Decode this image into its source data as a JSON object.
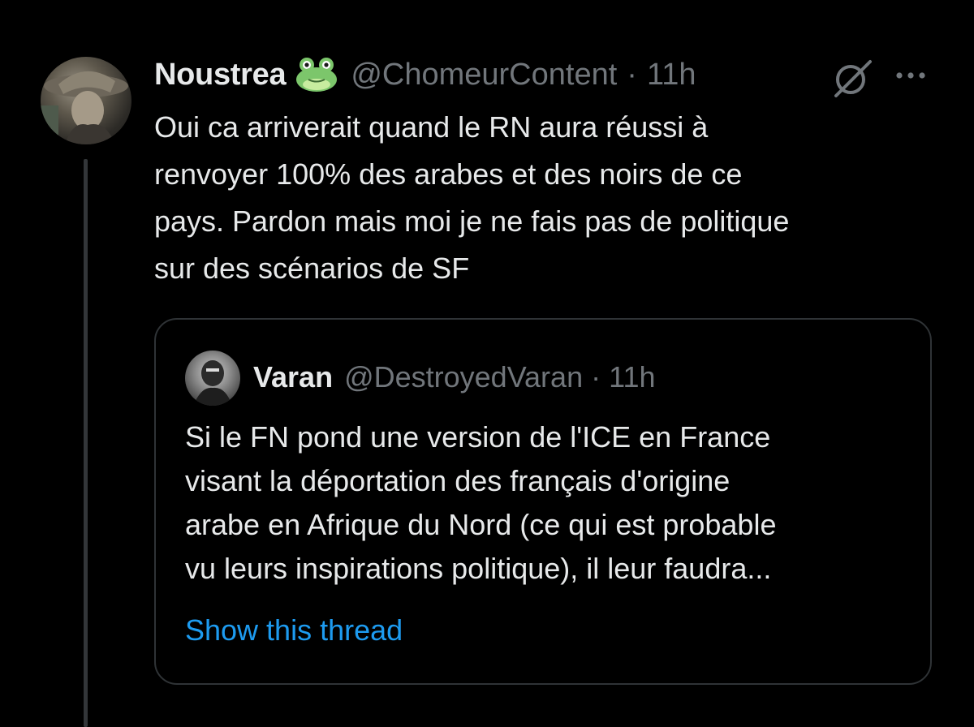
{
  "tweet": {
    "display_name": "Noustrea",
    "emoji_icon": "frog-face-icon",
    "handle": "@ChomeurContent",
    "separator": "·",
    "time": "11h",
    "text": "Oui ca arriverait quand le RN aura réussi à\nrenvoyer 100% des arabes et des noirs de ce\npays. Pardon mais moi je ne fais pas de politique\nsur des scénarios de SF",
    "actions": {
      "grok_icon": "grok-slash-circle-icon",
      "more_icon": "more-horizontal-icon"
    }
  },
  "quoted_tweet": {
    "display_name": "Varan",
    "handle": "@DestroyedVaran",
    "separator": "·",
    "time": "11h",
    "text": "Si le FN pond une version de l'ICE en France\nvisant la déportation des français d'origine\narabe en Afrique du Nord (ce qui est probable\nvu leurs inspirations politique), il leur faudra...",
    "show_thread_label": "Show this thread"
  },
  "colors": {
    "background": "#000000",
    "primary_text": "#e7e9ea",
    "secondary_text": "#71767b",
    "link": "#1d9bf0",
    "border": "#2f3336",
    "frog_green": "#7cc66b"
  }
}
